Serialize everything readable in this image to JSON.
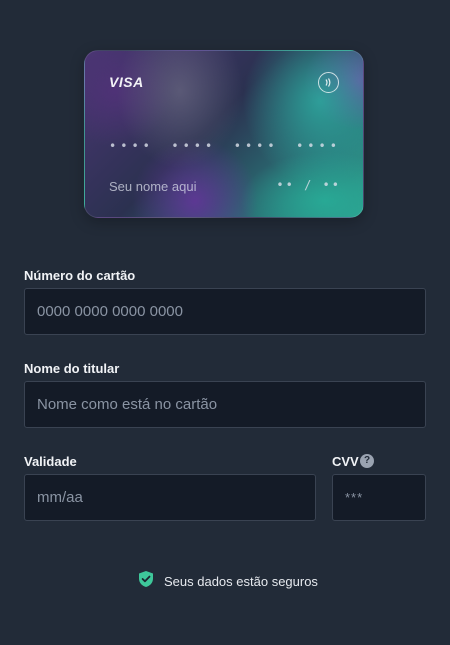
{
  "card": {
    "brand": "VISA",
    "number_groups": [
      "••••",
      "••••",
      "••••",
      "••••"
    ],
    "holder_placeholder": "Seu nome aqui",
    "expiry_placeholder": "•• / ••",
    "contactless_icon": "contactless-icon"
  },
  "form": {
    "card_number": {
      "label": "Número do cartão",
      "placeholder": "0000 0000 0000 0000",
      "value": ""
    },
    "holder_name": {
      "label": "Nome do titular",
      "placeholder": "Nome como está no cartão",
      "value": ""
    },
    "expiry": {
      "label": "Validade",
      "placeholder": "mm/aa",
      "value": ""
    },
    "cvv": {
      "label": "CVV",
      "placeholder": "***",
      "value": "",
      "help_icon": "question-circle-icon",
      "help_glyph": "?"
    }
  },
  "security": {
    "icon": "shield-check-icon",
    "text": "Seus dados estão seguros",
    "icon_color": "#3ec79a"
  },
  "colors": {
    "background": "#222b38",
    "input_background": "#141b27",
    "input_border": "#3a4352"
  }
}
